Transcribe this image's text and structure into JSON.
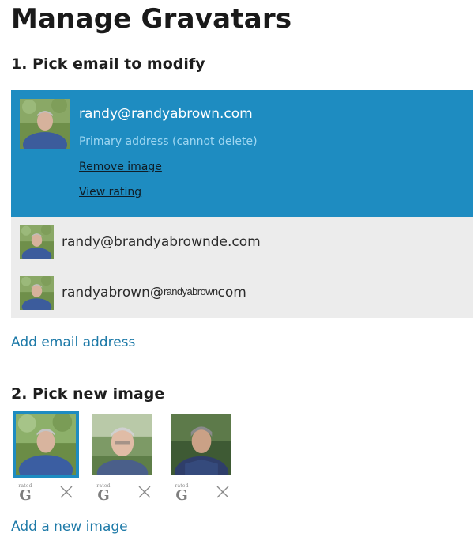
{
  "page": {
    "title": "Manage Gravatars"
  },
  "step1": {
    "heading": "1. Pick email to modify",
    "selected": {
      "email": "randy@randyabrown.com",
      "status": "Primary address (cannot delete)",
      "remove_image": "Remove image",
      "view_rating": "View rating",
      "avatar_icon": "avatar-photo-icon"
    },
    "others": [
      {
        "email": "randy@brandyabrownde.com"
      },
      {
        "email_prefix": "randyabrown@",
        "email_tag": "randyabrown",
        "email_suffix": "com"
      }
    ],
    "add_email": "Add email address"
  },
  "step2": {
    "heading": "2. Pick new image",
    "images": [
      {
        "rated_label": "rated",
        "rating": "G",
        "selected": true
      },
      {
        "rated_label": "rated",
        "rating": "G",
        "selected": false
      },
      {
        "rated_label": "rated",
        "rating": "G",
        "selected": false
      }
    ],
    "add_image": "Add a new image"
  },
  "colors": {
    "accent": "#1e8cc1",
    "link": "#1e7aa8",
    "row_background": "#ececec",
    "primary_status": "#9fd7f2"
  }
}
